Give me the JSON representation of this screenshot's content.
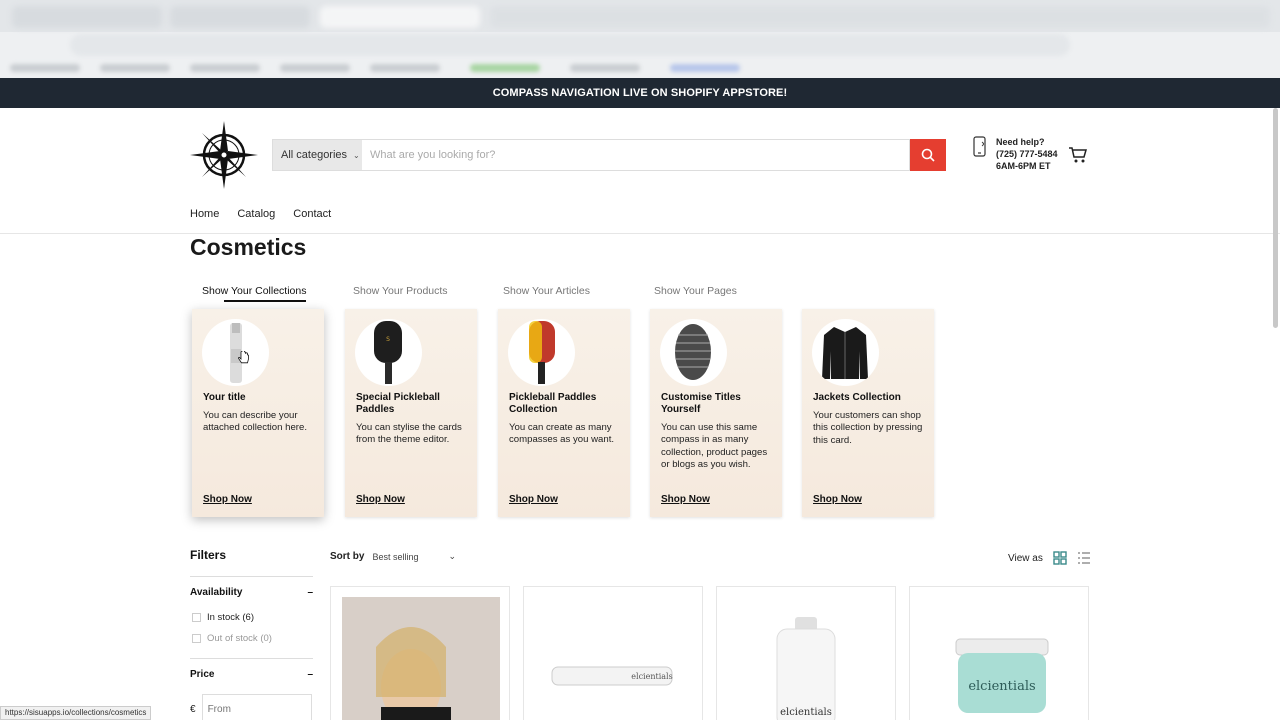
{
  "announcement": "COMPASS NAVIGATION LIVE ON SHOPIFY APPSTORE!",
  "search": {
    "category": "All categories",
    "placeholder": "What are you looking for?"
  },
  "help": {
    "line1": "Need help?",
    "line2": "(725) 777-5484",
    "line3": "6AM-6PM ET"
  },
  "nav": [
    "Home",
    "Catalog",
    "Contact"
  ],
  "page_title": "Cosmetics",
  "compass_tabs": [
    "Show Your Collections",
    "Show Your Products",
    "Show Your Articles",
    "Show Your Pages"
  ],
  "cards": [
    {
      "title": "Your title",
      "desc": "You can describe your attached collection here.",
      "cta": "Shop Now"
    },
    {
      "title": "Special Pickleball Paddles",
      "desc": "You can stylise the cards from the theme editor.",
      "cta": "Shop Now"
    },
    {
      "title": "Pickleball Paddles Collection",
      "desc": "You can create as many compasses as you want.",
      "cta": "Shop Now"
    },
    {
      "title": "Customise Titles Yourself",
      "desc": "You can use this same compass in as many collection, product pages or blogs as you wish.",
      "cta": "Shop Now"
    },
    {
      "title": "Jackets Collection",
      "desc": "Your customers can shop this collection by pressing this card.",
      "cta": "Shop Now"
    }
  ],
  "filters": {
    "title": "Filters",
    "availability": "Availability",
    "in_stock": "In stock (6)",
    "out_of_stock": "Out of stock (0)",
    "price": "Price",
    "currency": "€",
    "from_placeholder": "From"
  },
  "sort": {
    "label": "Sort by",
    "value": "Best selling"
  },
  "view_as": "View as",
  "status_url": "https://sisuapps.io/collections/cosmetics",
  "colors": {
    "search_button": "#e53e30",
    "announce_bg": "#1f2833",
    "grid_icon": "#3a8a8a"
  }
}
